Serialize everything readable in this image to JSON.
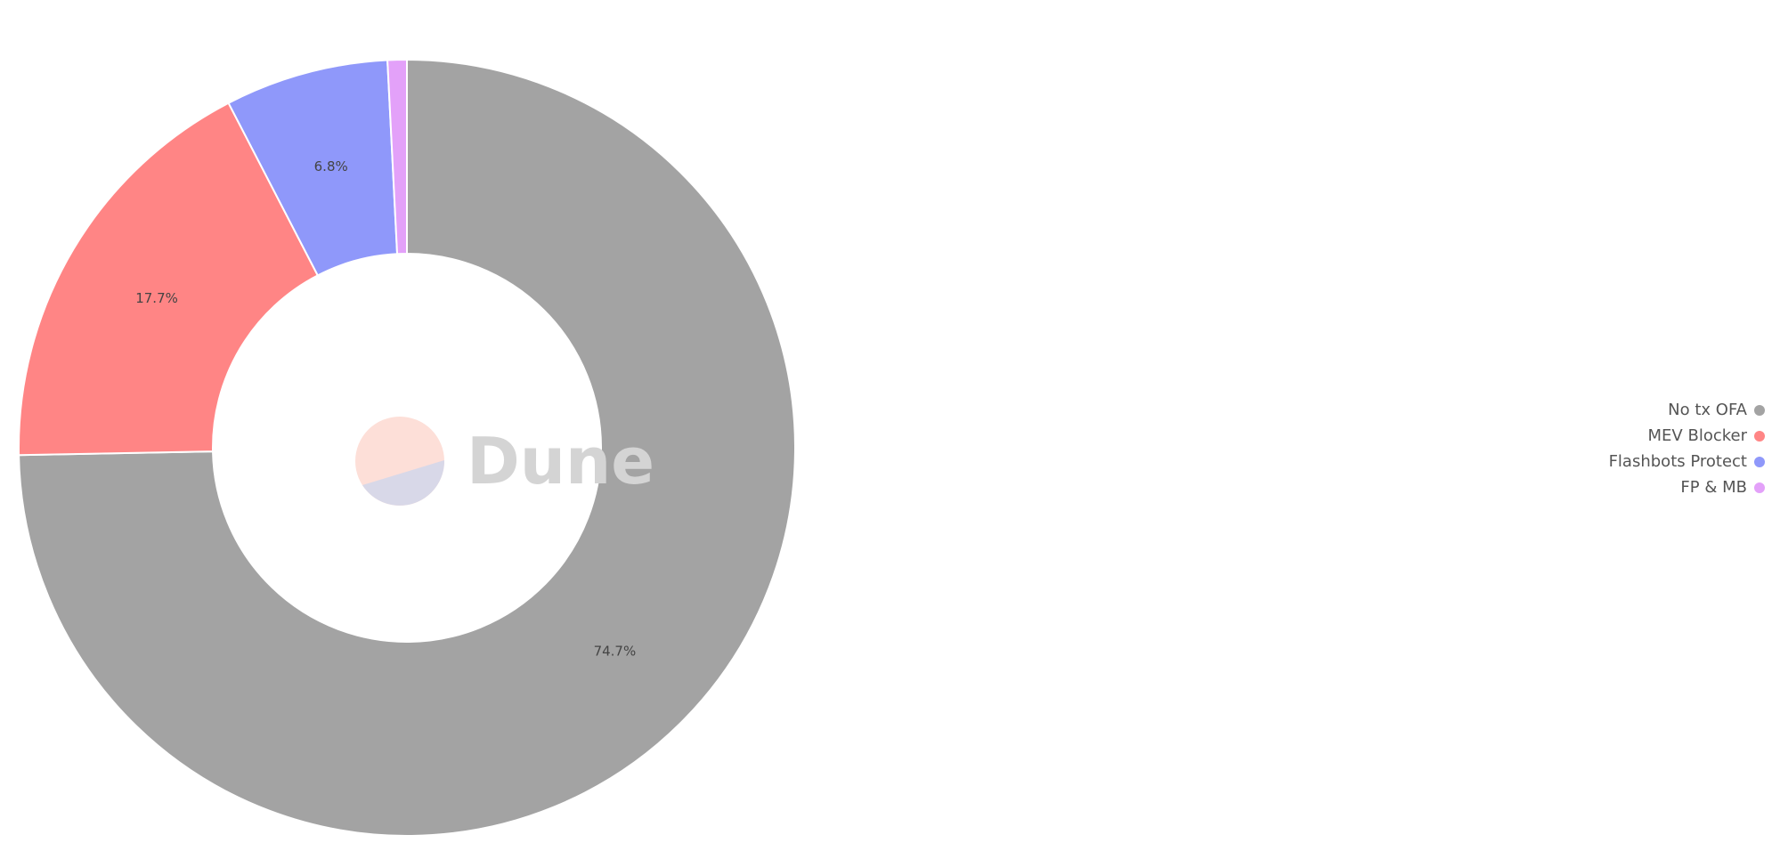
{
  "chart_data": {
    "type": "pie",
    "donut": true,
    "title": "",
    "categories": [
      "No tx OFA",
      "MEV Blocker",
      "Flashbots Protect",
      "FP & MB"
    ],
    "values": [
      74.7,
      17.7,
      6.8,
      0.8
    ],
    "labels": [
      "74.7%",
      "17.7%",
      "6.8%",
      ""
    ],
    "colors": [
      "#a3a3a3",
      "#ff8585",
      "#8f98fa",
      "#e3a1f9"
    ],
    "legend": {
      "position": "right",
      "entries": [
        "No tx OFA",
        "MEV Blocker",
        "Flashbots Protect",
        "FP & MB"
      ]
    }
  },
  "watermark": {
    "text": "Dune",
    "colors": [
      "#fddfd8",
      "#d8d8e8"
    ]
  }
}
